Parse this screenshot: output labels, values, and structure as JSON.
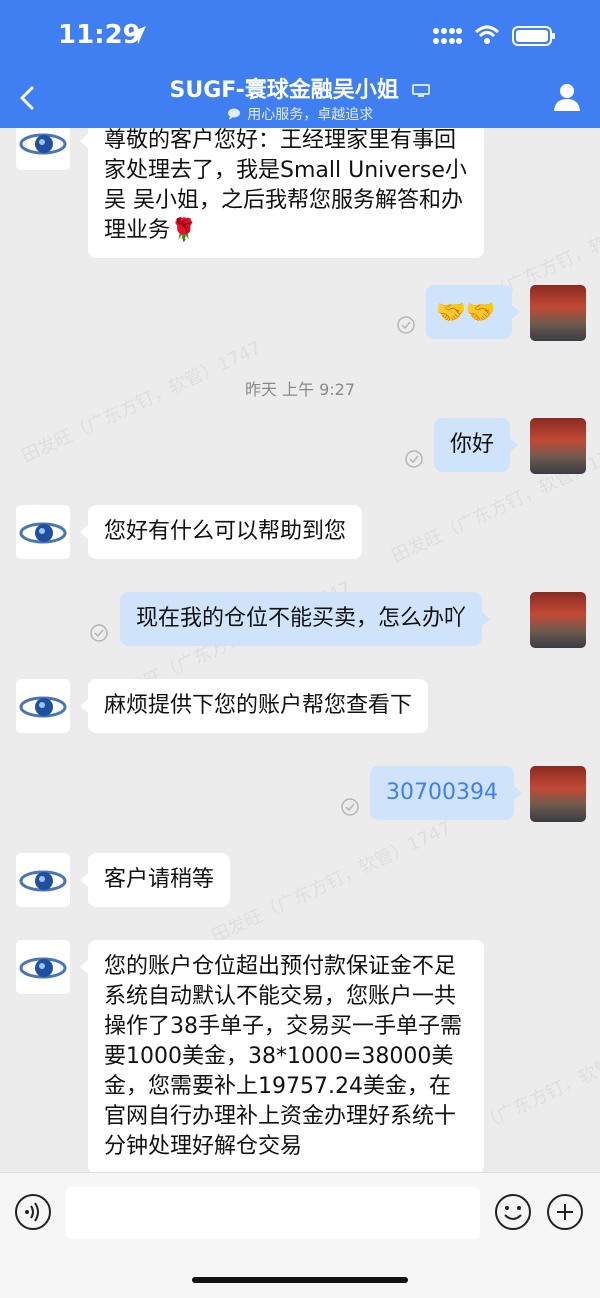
{
  "status_bar": {
    "time": "11:29"
  },
  "header": {
    "title": "SUGF-寰球金融吴小姐",
    "subtitle": "用心服务，卓越追求"
  },
  "watermark": "田发旺（广东方钉，软管）1747",
  "messages": [
    {
      "side": "left",
      "text": "尊敬的客户您好：王经理家里有事回家处理去了，我是Small Universe小吴 吴小姐，之后我帮您服务解答和办理业务🌹"
    },
    {
      "side": "right",
      "text": "🤝🤝"
    },
    {
      "type": "timestamp",
      "text": "昨天 上午 9:27"
    },
    {
      "side": "right",
      "text": "你好"
    },
    {
      "side": "left",
      "text": "您好有什么可以帮助到您"
    },
    {
      "side": "right",
      "text": "现在我的仓位不能买卖，怎么办吖"
    },
    {
      "side": "left",
      "text": "麻烦提供下您的账户帮您查看下"
    },
    {
      "side": "right",
      "text": "30700394"
    },
    {
      "side": "left",
      "text": "客户请稍等"
    },
    {
      "side": "left",
      "text": "您的账户仓位超出预付款保证金不足系统自动默认不能交易，您账户一共操作了38手单子，交易买一手单子需要1000美金，38*1000=38000美金，您需要补上19757.24美金，在官网自行办理补上资金办理好系统十分钟处理好解仓交易"
    }
  ],
  "input": {
    "placeholder": ""
  },
  "colors": {
    "accent": "#3f7ff2",
    "sent_bubble": "#cfe4fb",
    "received_bubble": "#ffffff",
    "background": "#ececec"
  }
}
